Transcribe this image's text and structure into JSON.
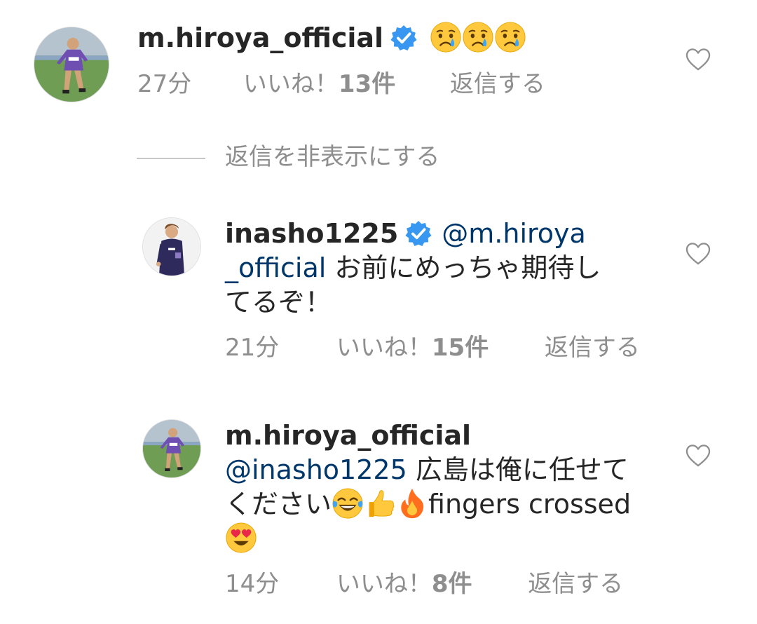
{
  "comments": [
    {
      "username": "m.hiroya_official",
      "verified": true,
      "emojis": [
        "crying-face",
        "crying-face",
        "crying-face"
      ],
      "time": "27分",
      "likes_prefix": "いいね！",
      "likes_count": "13件",
      "reply": "返信する"
    }
  ],
  "hide_replies": "返信を非表示にする",
  "replies": [
    {
      "username": "inasho1225",
      "verified": true,
      "mention": "@m.hiroya",
      "mention_cont": "_official",
      "text_1": " お前にめっちゃ期待し",
      "text_2": "てるぞ！",
      "time": "21分",
      "likes_prefix": "いいね！",
      "likes_count": "15件",
      "reply": "返信する"
    },
    {
      "username": "m.hiroya_official",
      "mention": "@inasho1225",
      "text_1": " 広島は俺に任せて",
      "text_2": "ください",
      "emojis": [
        "tears-of-joy",
        "thumbs-up",
        "fire"
      ],
      "text_3": "fingers crossed",
      "emoji_end": "heart-eyes",
      "time": "14分",
      "likes_prefix": "いいね！",
      "likes_count": "8件",
      "reply": "返信する"
    }
  ],
  "colors": {
    "text": "#262626",
    "muted": "#8e8e8e",
    "mention": "#00376b",
    "verified": "#3897f0"
  }
}
